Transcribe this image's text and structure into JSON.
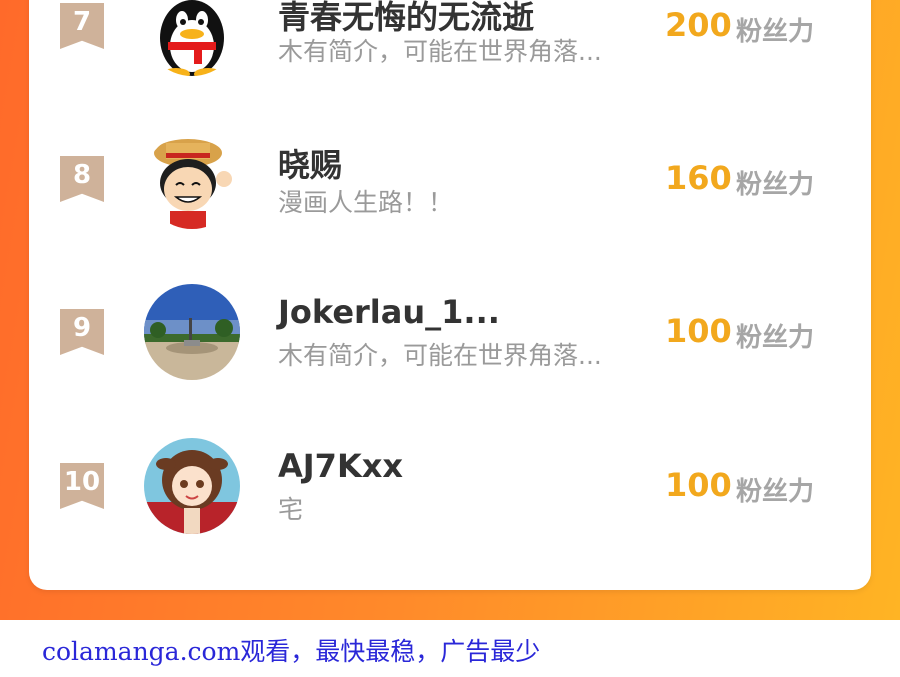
{
  "ranking": [
    {
      "rank": "7",
      "name": "青春无悔的无流逝",
      "bio": "木有简介，可能在世界角落...",
      "score": "200",
      "unit": "粉丝力",
      "avatar": "penguin-avatar"
    },
    {
      "rank": "8",
      "name": "晓赐",
      "bio": "漫画人生路！！",
      "score": "160",
      "unit": "粉丝力",
      "avatar": "cartoon-boy-avatar"
    },
    {
      "rank": "9",
      "name": "Jokerlau_1...",
      "bio": "木有简介，可能在世界角落...",
      "score": "100",
      "unit": "粉丝力",
      "avatar": "landscape-avatar"
    },
    {
      "rank": "10",
      "name": "AJ7Kxx",
      "bio": "宅",
      "score": "100",
      "unit": "粉丝力",
      "avatar": "anime-girl-avatar"
    }
  ],
  "footer": {
    "text": "colamanga.com观看，最快最稳，广告最少"
  },
  "colors": {
    "accent_score": "#f2a81d",
    "badge": "#cfb29a",
    "gradient_start": "#ff6a2a",
    "gradient_end": "#ffb424",
    "footer_link": "#2a27d8"
  }
}
